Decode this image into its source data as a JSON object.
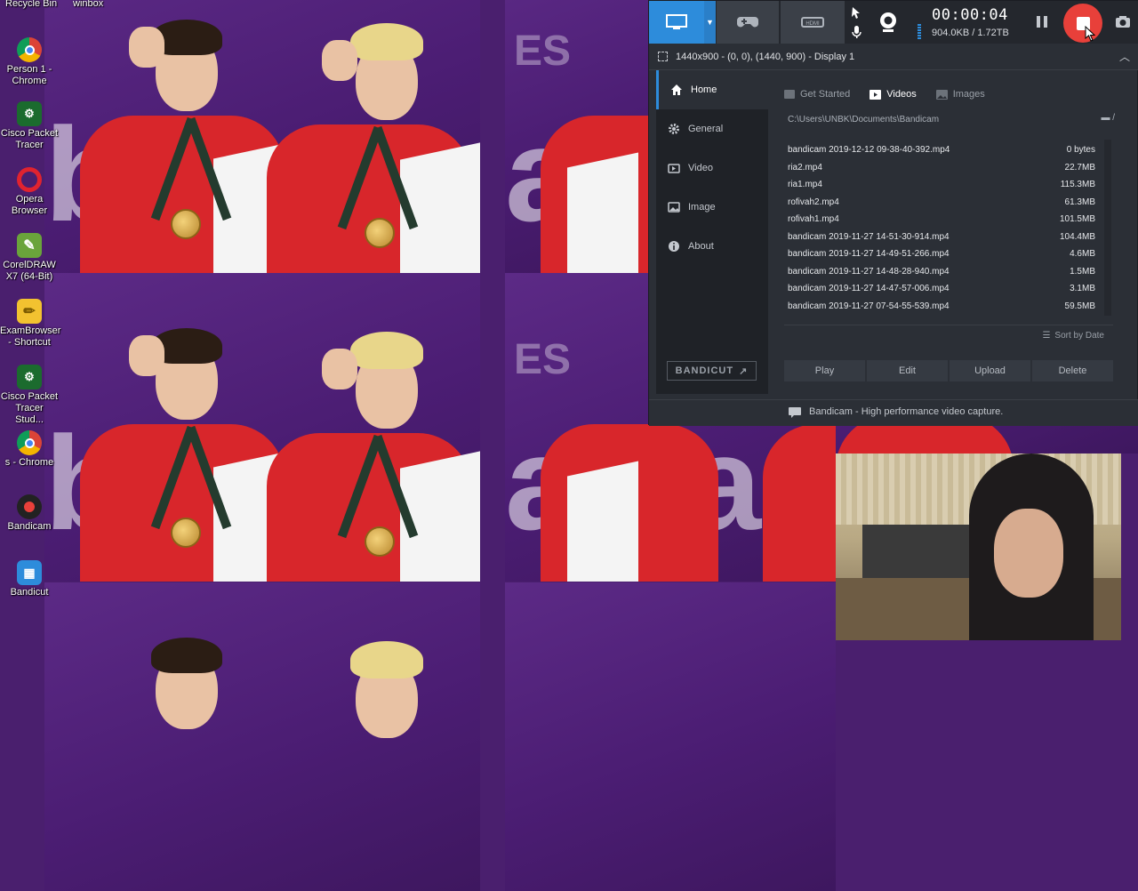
{
  "desktop": {
    "top_labels": [
      "Recycle Bin",
      "winbox"
    ],
    "icons": [
      {
        "label": "Person 1 - Chrome",
        "icon": "chrome-icon"
      },
      {
        "label": "Cisco Packet Tracer",
        "icon": "cisco-icon"
      },
      {
        "label": "Opera Browser",
        "icon": "opera-icon"
      },
      {
        "label": "CorelDRAW X7 (64-Bit)",
        "icon": "coreldraw-icon"
      },
      {
        "label": "ExamBrowser - Shortcut",
        "icon": "exam-icon"
      },
      {
        "label": "Cisco Packet Tracer Stud...",
        "icon": "cisco-icon"
      },
      {
        "label": "s - Chrome",
        "icon": "chrome-icon"
      },
      {
        "label": "Bandicam",
        "icon": "bandicam-icon"
      },
      {
        "label": "Bandicut",
        "icon": "bandicut-icon"
      }
    ]
  },
  "bandicam": {
    "timer": "00:00:04",
    "size": "904.0KB / 1.72TB",
    "capture_target": "1440x900 - (0, 0), (1440, 900) - Display 1",
    "nav": [
      {
        "label": "Home",
        "icon": "home-icon",
        "active": true
      },
      {
        "label": "General",
        "icon": "gear-icon",
        "active": false
      },
      {
        "label": "Video",
        "icon": "video-icon",
        "active": false
      },
      {
        "label": "Image",
        "icon": "image-icon",
        "active": false
      },
      {
        "label": "About",
        "icon": "info-icon",
        "active": false
      }
    ],
    "bandicut_label": "BANDICUT",
    "tabs": [
      {
        "label": "Get Started",
        "active": false
      },
      {
        "label": "Videos",
        "active": true
      },
      {
        "label": "Images",
        "active": false
      }
    ],
    "path": "C:\\Users\\UNBK\\Documents\\Bandicam",
    "path_suffix": "/",
    "files": [
      {
        "name": "bandicam 2019-12-12 09-38-40-392.mp4",
        "size": "0 bytes"
      },
      {
        "name": "ria2.mp4",
        "size": "22.7MB"
      },
      {
        "name": "ria1.mp4",
        "size": "115.3MB"
      },
      {
        "name": "rofivah2.mp4",
        "size": "61.3MB"
      },
      {
        "name": "rofivah1.mp4",
        "size": "101.5MB"
      },
      {
        "name": "bandicam 2019-11-27 14-51-30-914.mp4",
        "size": "104.4MB"
      },
      {
        "name": "bandicam 2019-11-27 14-49-51-266.mp4",
        "size": "4.6MB"
      },
      {
        "name": "bandicam 2019-11-27 14-48-28-940.mp4",
        "size": "1.5MB"
      },
      {
        "name": "bandicam 2019-11-27 14-47-57-006.mp4",
        "size": "3.1MB"
      },
      {
        "name": "bandicam 2019-11-27 07-54-55-539.mp4",
        "size": "59.5MB"
      }
    ],
    "sort_label": "Sort by Date",
    "actions": [
      "Play",
      "Edit",
      "Upload",
      "Delete"
    ],
    "footer": "Bandicam - High performance video capture.",
    "accent": "#2d8cdb",
    "record_color": "#e8403a"
  }
}
